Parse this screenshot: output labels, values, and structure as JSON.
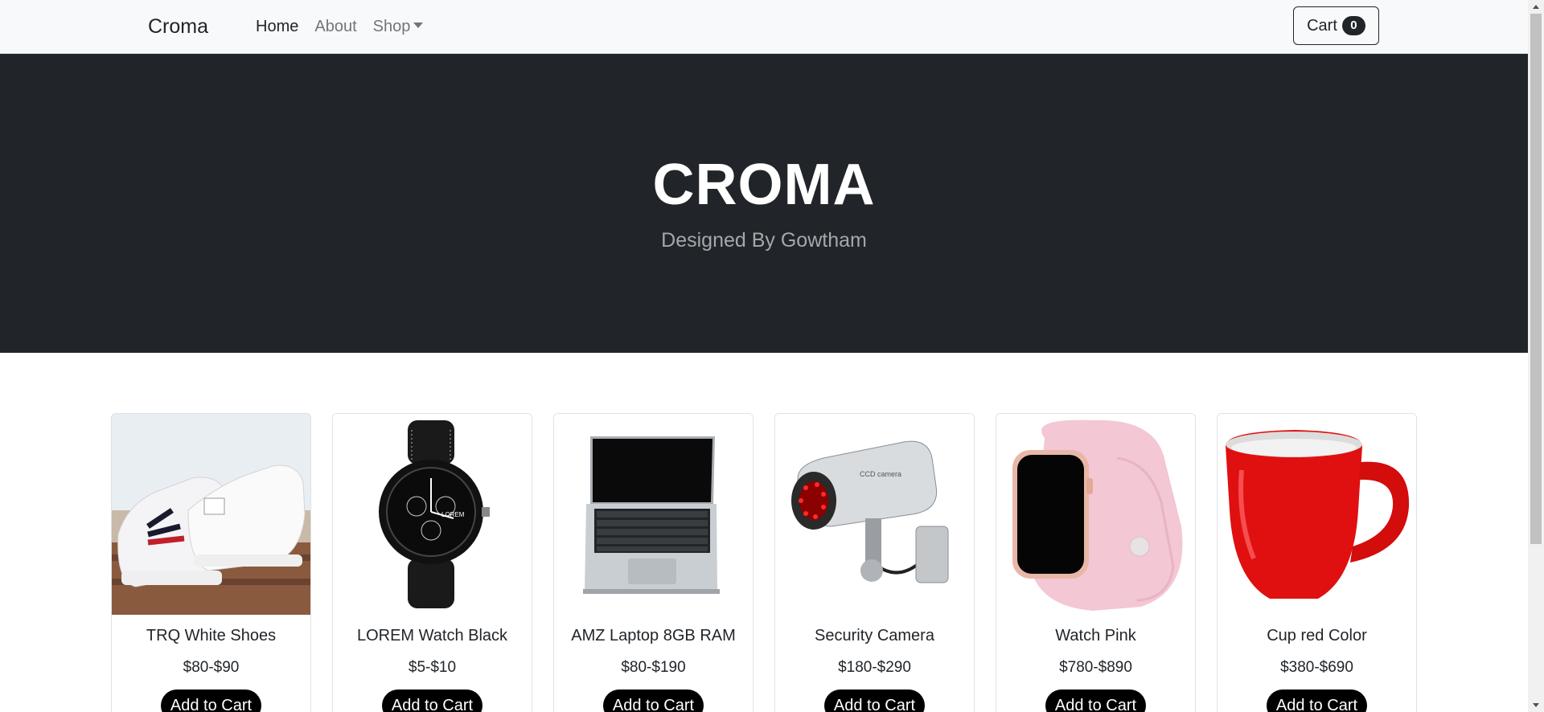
{
  "navbar": {
    "brand": "Croma",
    "links": {
      "home": "Home",
      "about": "About",
      "shop": "Shop"
    },
    "cart": {
      "label": "Cart",
      "count": "0"
    }
  },
  "hero": {
    "title": "CROMA",
    "subtitle": "Designed By Gowtham"
  },
  "products": [
    {
      "name": "TRQ White Shoes",
      "price": "$80-$90",
      "button": "Add to Cart",
      "icon": "sneakers-image"
    },
    {
      "name": "LOREM Watch Black",
      "price": "$5-$10",
      "button": "Add to Cart",
      "icon": "watch-image"
    },
    {
      "name": "AMZ Laptop 8GB RAM",
      "price": "$80-$190",
      "button": "Add to Cart",
      "icon": "laptop-image"
    },
    {
      "name": "Security Camera",
      "price": "$180-$290",
      "button": "Add to Cart",
      "icon": "camera-image"
    },
    {
      "name": "Watch Pink",
      "price": "$780-$890",
      "button": "Add to Cart",
      "icon": "smartwatch-image"
    },
    {
      "name": "Cup red Color",
      "price": "$380-$690",
      "button": "Add to Cart",
      "icon": "mug-image"
    }
  ],
  "colors": {
    "navbar_bg": "#f8f9fa",
    "hero_bg": "#212529",
    "button_bg": "#000000"
  }
}
